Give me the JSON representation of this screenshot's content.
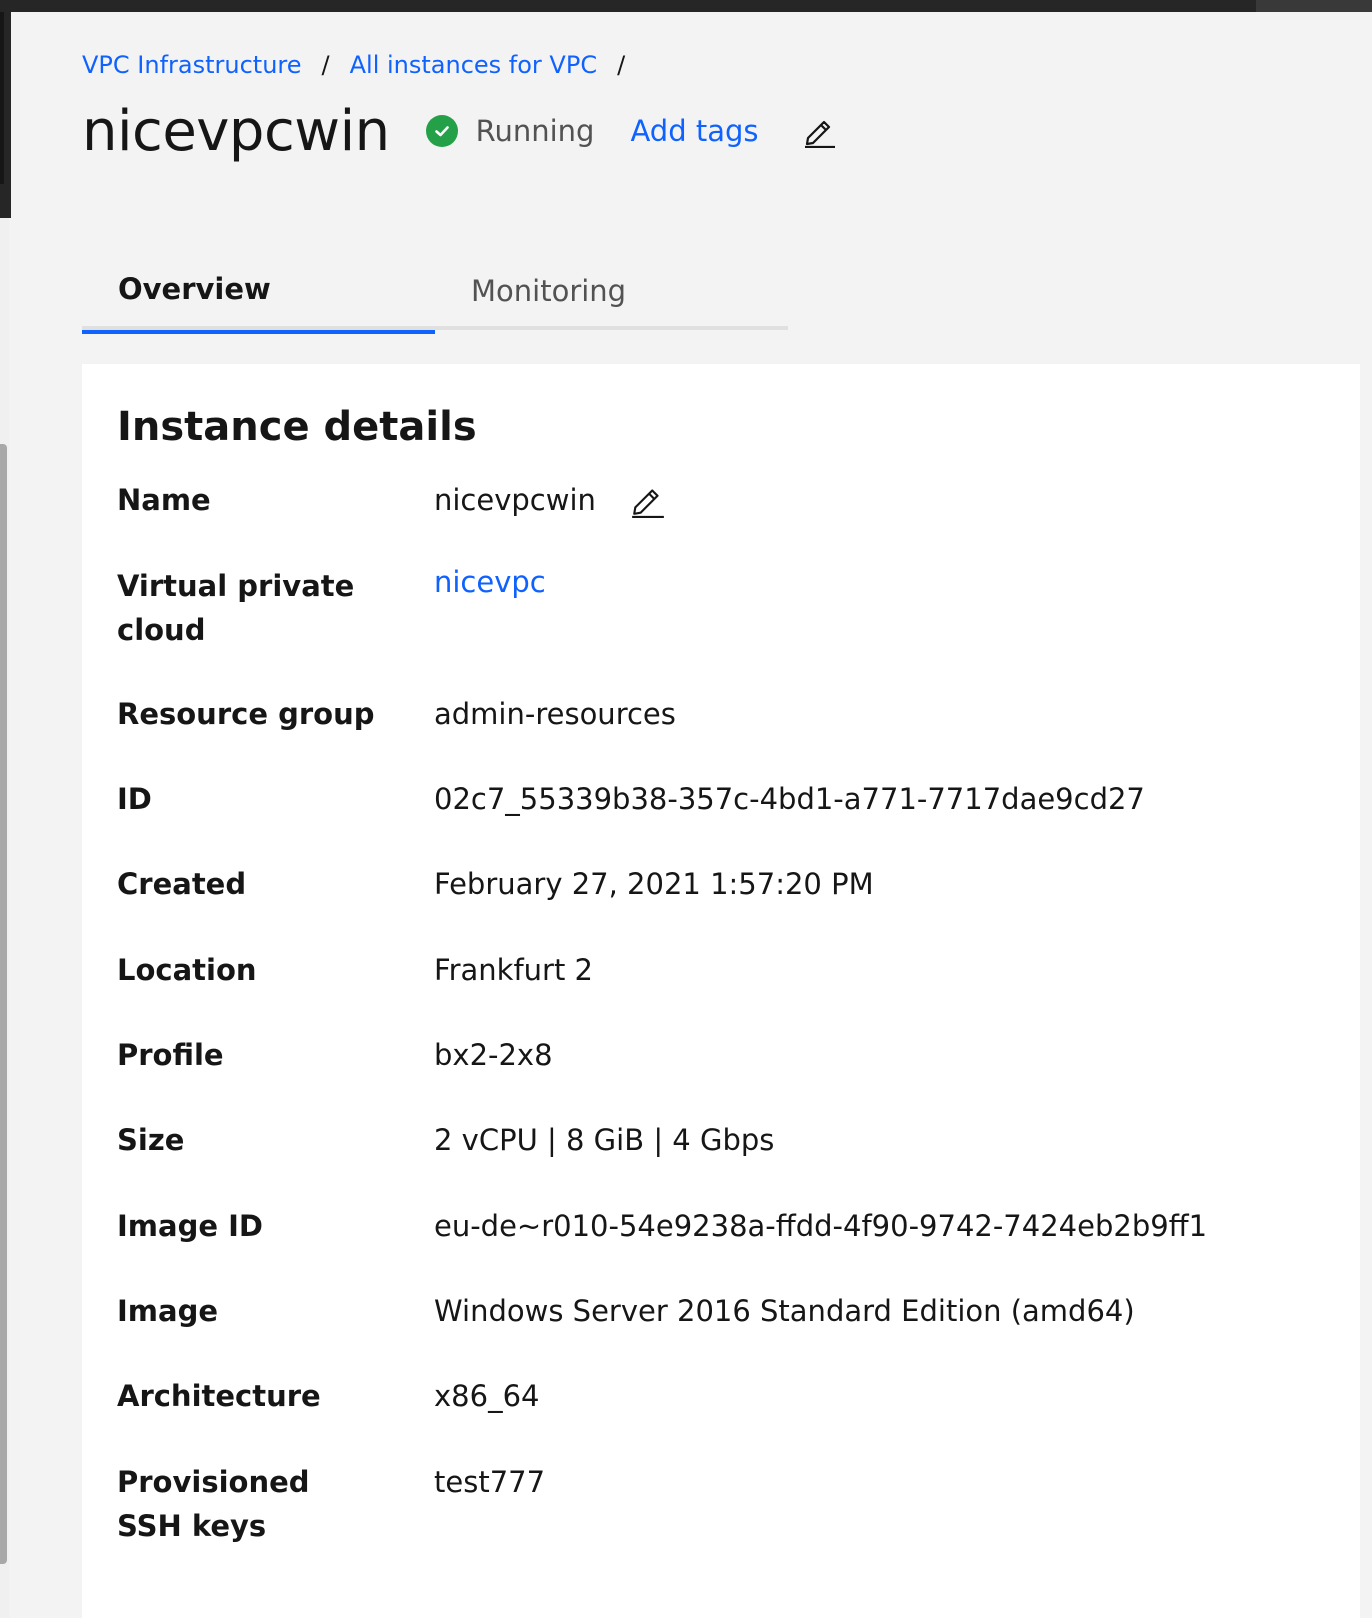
{
  "breadcrumb": {
    "items": [
      "VPC Infrastructure",
      "All instances for VPC"
    ],
    "separator": "/"
  },
  "header": {
    "title": "nicevpcwin",
    "status": "Running",
    "status_color": "#24a148",
    "add_tags_label": "Add tags",
    "edit_icon": "edit-pencil-icon"
  },
  "tabs": [
    {
      "label": "Overview",
      "active": true
    },
    {
      "label": "Monitoring",
      "active": false
    }
  ],
  "details": {
    "title": "Instance details",
    "rows": [
      {
        "label": "Name",
        "value": "nicevpcwin"
      },
      {
        "label": "Virtual private cloud",
        "value": "nicevpc"
      },
      {
        "label": "Resource group",
        "value": "admin-resources"
      },
      {
        "label": "ID",
        "value": "02c7_55339b38-357c-4bd1-a771-7717dae9cd27"
      },
      {
        "label": "Created",
        "value": "February 27, 2021 1:57:20 PM"
      },
      {
        "label": "Location",
        "value": "Frankfurt 2"
      },
      {
        "label": "Profile",
        "value": "bx2-2x8"
      },
      {
        "label": "Size",
        "value": "2 vCPU | 8 GiB | 4 Gbps"
      },
      {
        "label": "Image ID",
        "value": "eu-de~r010-54e9238a-ffdd-4f90-9742-7424eb2b9ff1"
      },
      {
        "label": "Image",
        "value": "Windows Server 2016 Standard Edition (amd64)"
      },
      {
        "label": "Architecture",
        "value": "x86_64"
      },
      {
        "label": "Provisioned SSH keys",
        "value": "test777"
      }
    ]
  },
  "colors": {
    "link": "#0f62fe",
    "active_tab_underline": "#0f62fe",
    "page_background": "#f3f3f3",
    "card_background": "#ffffff"
  }
}
